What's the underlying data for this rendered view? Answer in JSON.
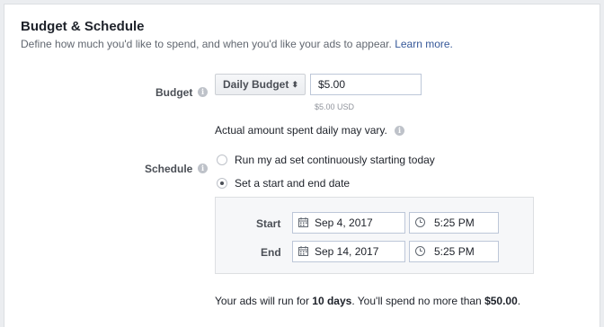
{
  "section": {
    "title": "Budget & Schedule",
    "subtitle": "Define how much you'd like to spend, and when you'd like your ads to appear.",
    "learn_more": "Learn more."
  },
  "budget": {
    "label": "Budget",
    "type_select": "Daily Budget",
    "amount_value": "$5.00",
    "amount_usd": "$5.00 USD",
    "note": "Actual amount spent daily may vary."
  },
  "schedule": {
    "label": "Schedule",
    "options": [
      {
        "label": "Run my ad set continuously starting today",
        "selected": false
      },
      {
        "label": "Set a start and end date",
        "selected": true
      }
    ],
    "start": {
      "label": "Start",
      "date": "Sep 4, 2017",
      "time": "5:25 PM"
    },
    "end": {
      "label": "End",
      "date": "Sep 14, 2017",
      "time": "5:25 PM"
    }
  },
  "summary": {
    "prefix": "Your ads will run for ",
    "days": "10 days",
    "middle": ". You'll spend no more than ",
    "amount": "$50.00",
    "suffix": "."
  },
  "icons": {
    "info": "info-icon",
    "calendar": "calendar-icon",
    "clock": "clock-icon",
    "select_arrows": "up-down-arrows-icon"
  },
  "colors": {
    "link": "#365899",
    "label": "#4b4f56",
    "border": "#dddfe2"
  }
}
